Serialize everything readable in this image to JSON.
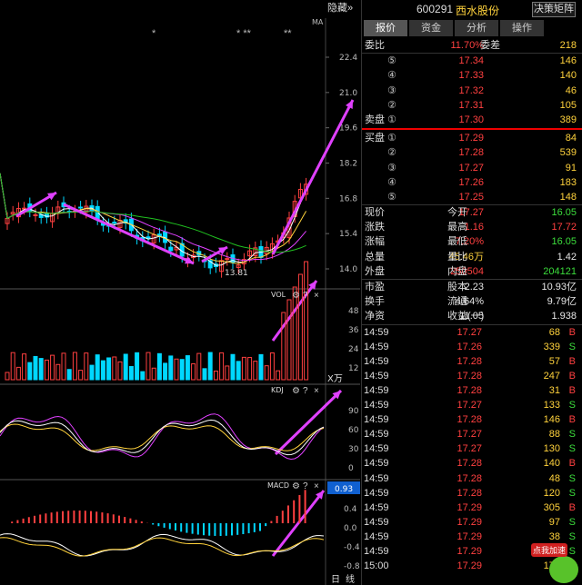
{
  "header": {
    "hide_label": "隐藏",
    "hide_arrows": "»",
    "code": "600291",
    "name": "西水股份",
    "decide_label": "决策矩阵"
  },
  "tabs": [
    "报价",
    "资金",
    "分析",
    "操作"
  ],
  "committee": {
    "ratio_label": "委比",
    "ratio": "11.70%",
    "diff_label": "委差",
    "diff": "218"
  },
  "sell_label": "卖盘",
  "buy_label": "买盘",
  "asks": [
    {
      "level": "⑤",
      "price": "17.34",
      "vol": "146"
    },
    {
      "level": "④",
      "price": "17.33",
      "vol": "140"
    },
    {
      "level": "③",
      "price": "17.32",
      "vol": "46"
    },
    {
      "level": "②",
      "price": "17.31",
      "vol": "105"
    },
    {
      "level": "①",
      "price": "17.30",
      "vol": "389"
    }
  ],
  "bids": [
    {
      "level": "①",
      "price": "17.29",
      "vol": "84"
    },
    {
      "level": "②",
      "price": "17.28",
      "vol": "539"
    },
    {
      "level": "③",
      "price": "17.27",
      "vol": "91"
    },
    {
      "level": "④",
      "price": "17.26",
      "vol": "183"
    },
    {
      "level": "⑤",
      "price": "17.25",
      "vol": "148"
    }
  ],
  "quote": [
    {
      "l1": "现价",
      "v1": "17.27",
      "c1": "red",
      "l2": "今开",
      "v2": "16.05",
      "c2": "green"
    },
    {
      "l1": "涨跌",
      "v1": "1.16",
      "c1": "red",
      "l2": "最高",
      "v2": "17.72",
      "c2": "red"
    },
    {
      "l1": "涨幅",
      "v1": "7.20%",
      "c1": "red",
      "l2": "最低",
      "v2": "16.05",
      "c2": "green"
    },
    {
      "l1": "总量",
      "v1": "45.46万",
      "c1": "yellow",
      "l2": "量比",
      "v2": "1.42",
      "c2": "white"
    },
    {
      "l1": "外盘",
      "v1": "250504",
      "c1": "red",
      "l2": "内盘",
      "v2": "204121",
      "c2": "green"
    }
  ],
  "fundamentals": [
    {
      "l1": "市盈",
      "v1": "2.23",
      "l2": "股本",
      "v2": "10.93亿"
    },
    {
      "l1": "换手",
      "v1": "4.64%",
      "l2": "流通",
      "v2": "9.79亿"
    },
    {
      "l1": "净资",
      "v1": "11.05",
      "l2": "收益(一)",
      "v2": "1.938"
    }
  ],
  "ticks": [
    {
      "time": "14:59",
      "price": "17.27",
      "vol": "68",
      "dir": "B"
    },
    {
      "time": "14:59",
      "price": "17.26",
      "vol": "339",
      "dir": "S"
    },
    {
      "time": "14:59",
      "price": "17.28",
      "vol": "57",
      "dir": "B"
    },
    {
      "time": "14:59",
      "price": "17.28",
      "vol": "247",
      "dir": "B"
    },
    {
      "time": "14:59",
      "price": "17.28",
      "vol": "31",
      "dir": "B"
    },
    {
      "time": "14:59",
      "price": "17.27",
      "vol": "133",
      "dir": "S"
    },
    {
      "time": "14:59",
      "price": "17.28",
      "vol": "146",
      "dir": "B"
    },
    {
      "time": "14:59",
      "price": "17.27",
      "vol": "88",
      "dir": "S"
    },
    {
      "time": "14:59",
      "price": "17.27",
      "vol": "130",
      "dir": "S"
    },
    {
      "time": "14:59",
      "price": "17.28",
      "vol": "140",
      "dir": "B"
    },
    {
      "time": "14:59",
      "price": "17.28",
      "vol": "48",
      "dir": "S"
    },
    {
      "time": "14:59",
      "price": "17.28",
      "vol": "120",
      "dir": "S"
    },
    {
      "time": "14:59",
      "price": "17.29",
      "vol": "305",
      "dir": "B"
    },
    {
      "time": "14:59",
      "price": "17.29",
      "vol": "97",
      "dir": "S"
    },
    {
      "time": "14:59",
      "price": "17.29",
      "vol": "38",
      "dir": "S"
    },
    {
      "time": "14:59",
      "price": "17.29",
      "vol": "53",
      "dir": "S"
    },
    {
      "time": "15:00",
      "price": "17.29",
      "vol": "174",
      "dir": "S"
    }
  ],
  "promo_label": "点我加速",
  "chart": {
    "ma_label": "MA",
    "price_ticks": [
      "22.4",
      "21.0",
      "19.6",
      "18.2",
      "16.8",
      "15.4",
      "14.0"
    ],
    "low_marker": "13.81",
    "vol_label": "VOL",
    "vol_ticks": [
      "48",
      "36",
      "24",
      "12"
    ],
    "vol_unit": "X万",
    "kdj_label": "KDJ",
    "kdj_ticks": [
      "90",
      "60",
      "30",
      "0"
    ],
    "macd_label": "MACD",
    "macd_value": "0.93",
    "macd_ticks": [
      "0.4",
      "0.0",
      "-0.4",
      "-0.8"
    ],
    "gear_icon": "gear-icon",
    "help_icon": "?",
    "close_icon": "×",
    "period_day": "日",
    "period_line": "线"
  },
  "colors": {
    "up": "#ff4040",
    "down": "#3cdd3c",
    "cyan": "#00d8ff",
    "arrow": "#e040ff",
    "ma5": "#ffffff",
    "ma10": "#ffd23c",
    "ma20": "#e040ff",
    "ma60": "#20c020"
  }
}
